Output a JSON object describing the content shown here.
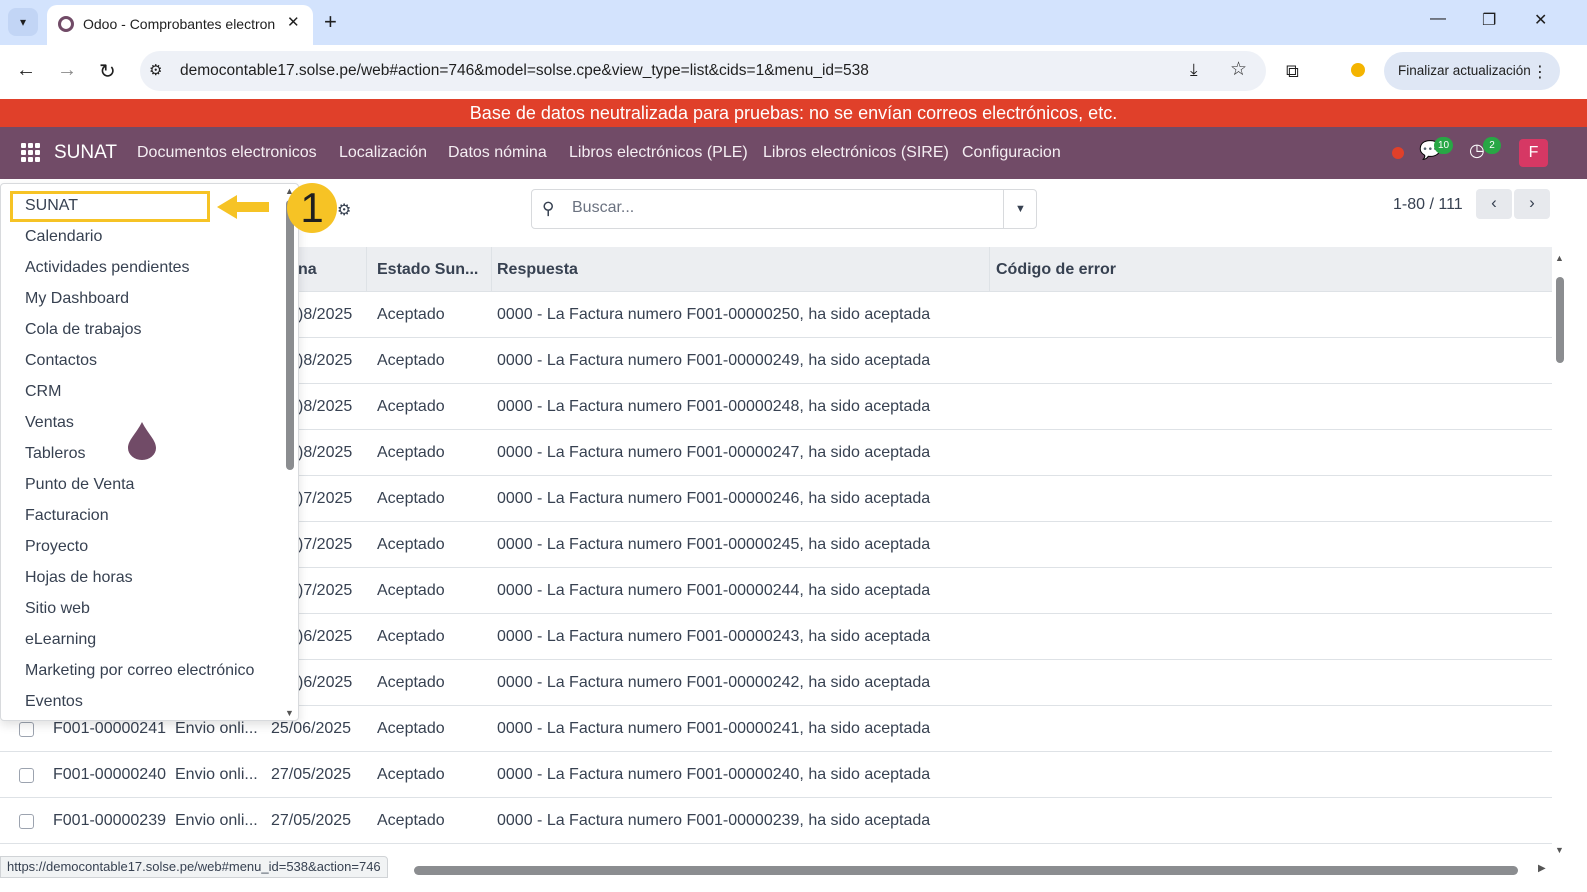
{
  "browser": {
    "tab_title": "Odoo - Comprobantes electron",
    "url": "democontable17.solse.pe/web#action=746&model=solse.cpe&view_type=list&cids=1&menu_id=538",
    "update_button": "Finalizar actualización",
    "status_url": "https://democontable17.solse.pe/web#menu_id=538&action=746"
  },
  "banner": "Base de datos neutralizada para pruebas: no se envían correos electrónicos, etc.",
  "navbar": {
    "brand": "SUNAT",
    "menu": [
      "Documentos electronicos",
      "Localización",
      "Datos nómina",
      "Libros electrónicos (PLE)",
      "Libros electrónicos (SIRE)",
      "Configuracion"
    ],
    "messages_badge": "10",
    "activities_badge": "2",
    "avatar_letter": "F"
  },
  "search": {
    "placeholder": "Buscar..."
  },
  "pager": {
    "value": "1-80 / 111"
  },
  "annotation": {
    "step": "1"
  },
  "list": {
    "headers": [
      "na",
      "Estado Sun...",
      "Respuesta",
      "Código de error"
    ],
    "partial_rows": [
      {
        "fecha": ")8/2025",
        "estado": "Aceptado",
        "respuesta": "0000 - La Factura numero F001-00000250, ha sido aceptada"
      },
      {
        "fecha": ")8/2025",
        "estado": "Aceptado",
        "respuesta": "0000 - La Factura numero F001-00000249, ha sido aceptada"
      },
      {
        "fecha": ")8/2025",
        "estado": "Aceptado",
        "respuesta": "0000 - La Factura numero F001-00000248, ha sido aceptada"
      },
      {
        "fecha": ")8/2025",
        "estado": "Aceptado",
        "respuesta": "0000 - La Factura numero F001-00000247, ha sido aceptada"
      },
      {
        "fecha": ")7/2025",
        "estado": "Aceptado",
        "respuesta": "0000 - La Factura numero F001-00000246, ha sido aceptada"
      },
      {
        "fecha": ")7/2025",
        "estado": "Aceptado",
        "respuesta": "0000 - La Factura numero F001-00000245, ha sido aceptada"
      },
      {
        "fecha": ")7/2025",
        "estado": "Aceptado",
        "respuesta": "0000 - La Factura numero F001-00000244, ha sido aceptada"
      },
      {
        "fecha": ")6/2025",
        "estado": "Aceptado",
        "respuesta": "0000 - La Factura numero F001-00000243, ha sido aceptada"
      },
      {
        "fecha": ")6/2025",
        "estado": "Aceptado",
        "respuesta": "0000 - La Factura numero F001-00000242, ha sido aceptada"
      }
    ],
    "full_rows": [
      {
        "numero": "F001-00000241",
        "tipo": "Envio onli...",
        "fecha": "25/06/2025",
        "estado": "Aceptado",
        "respuesta": "0000 - La Factura numero F001-00000241, ha sido aceptada"
      },
      {
        "numero": "F001-00000240",
        "tipo": "Envio onli...",
        "fecha": "27/05/2025",
        "estado": "Aceptado",
        "respuesta": "0000 - La Factura numero F001-00000240, ha sido aceptada"
      },
      {
        "numero": "F001-00000239",
        "tipo": "Envio onli...",
        "fecha": "27/05/2025",
        "estado": "Aceptado",
        "respuesta": "0000 - La Factura numero F001-00000239, ha sido aceptada"
      }
    ]
  },
  "app_menu": [
    "SUNAT",
    "Calendario",
    "Actividades pendientes",
    "My Dashboard",
    "Cola de trabajos",
    "Contactos",
    "CRM",
    "Ventas",
    "Tableros",
    "Punto de Venta",
    "Facturacion",
    "Proyecto",
    "Hojas de horas",
    "Sitio web",
    "eLearning",
    "Marketing por correo electrónico",
    "Eventos"
  ],
  "colors": {
    "odoo_primary": "#714B67",
    "banner": "#e0402a",
    "highlight": "#f6c325"
  }
}
